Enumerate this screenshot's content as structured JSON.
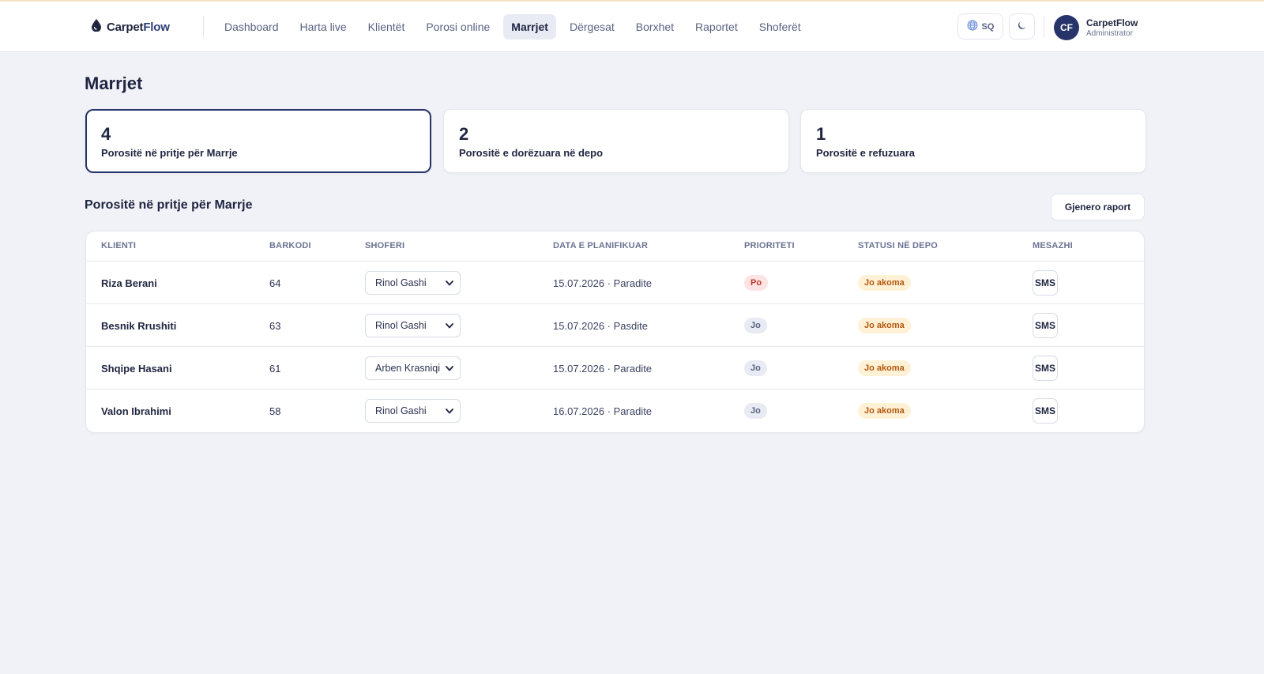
{
  "brand": {
    "name_part1": "Carpet",
    "name_part2": "Flow"
  },
  "nav": {
    "items": [
      {
        "label": "Dashboard"
      },
      {
        "label": "Harta live"
      },
      {
        "label": "Klientët"
      },
      {
        "label": "Porosi online"
      },
      {
        "label": "Marrjet",
        "active": true
      },
      {
        "label": "Dërgesat"
      },
      {
        "label": "Borxhet"
      },
      {
        "label": "Raportet"
      },
      {
        "label": "Shoferët"
      }
    ]
  },
  "header": {
    "language": "SQ",
    "user": {
      "initials": "CF",
      "name": "CarpetFlow",
      "role": "Administrator"
    }
  },
  "page": {
    "title": "Marrjet"
  },
  "stats": [
    {
      "value": "4",
      "label": "Porositë në pritje për Marrje",
      "selected": true
    },
    {
      "value": "2",
      "label": "Porositë e dorëzuara në depo",
      "selected": false
    },
    {
      "value": "1",
      "label": "Porositë e refuzuara",
      "selected": false
    }
  ],
  "section": {
    "title": "Porositë në pritje për Marrje",
    "report_button": "Gjenero raport"
  },
  "table": {
    "columns": [
      "KLIENTI",
      "BARKODI",
      "SHOFERI",
      "DATA E PLANIFIKUAR",
      "PRIORITETI",
      "STATUSI NË DEPO",
      "MESAZHI"
    ],
    "rows": [
      {
        "client": "Riza Berani",
        "barcode": "64",
        "driver": "Rinol Gashi",
        "date": "15.07.2026 · Paradite",
        "priority": "Po",
        "status": "Jo akoma",
        "message": "SMS"
      },
      {
        "client": "Besnik Rrushiti",
        "barcode": "63",
        "driver": "Rinol Gashi",
        "date": "15.07.2026 · Pasdite",
        "priority": "Jo",
        "status": "Jo akoma",
        "message": "SMS"
      },
      {
        "client": "Shqipe Hasani",
        "barcode": "61",
        "driver": "Arben Krasniqi",
        "date": "15.07.2026 · Paradite",
        "priority": "Jo",
        "status": "Jo akoma",
        "message": "SMS"
      },
      {
        "client": "Valon Ibrahimi",
        "barcode": "58",
        "driver": "Rinol Gashi",
        "date": "16.07.2026 · Paradite",
        "priority": "Jo",
        "status": "Jo akoma",
        "message": "SMS"
      }
    ]
  },
  "icons": {
    "brand": "drop-icon",
    "language": "globe-icon",
    "theme": "moon-icon",
    "select": "chevron-down-icon"
  },
  "colors": {
    "accent": "#27346a",
    "priority_yes": "#c0392b",
    "status_pending": "#b4570c",
    "page_bg": "#f1f2f7"
  }
}
